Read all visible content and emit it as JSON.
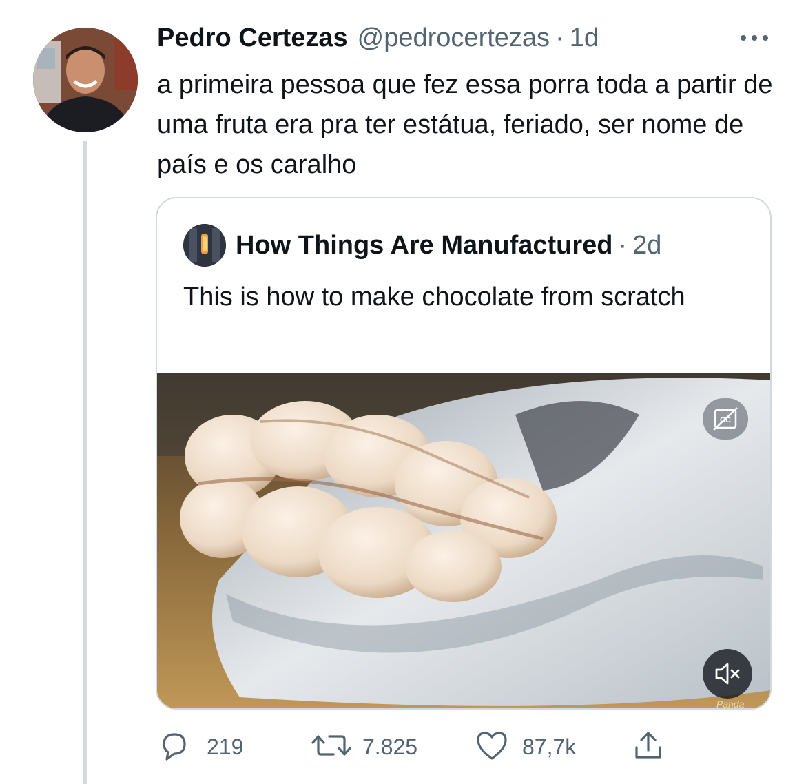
{
  "tweet": {
    "display_name": "Pedro Certezas",
    "handle": "@pedrocertezas",
    "separator": "·",
    "time": "1d",
    "text": "a primeira pessoa que fez essa porra toda a partir de uma fruta era pra ter estátua, feriado, ser nome de país e os caralho"
  },
  "quoted": {
    "display_name": "How Things Are Manufactured",
    "separator": "·",
    "time": "2d",
    "text": "This is how to make chocolate from scratch",
    "media_watermark": "Panda"
  },
  "actions": {
    "replies": "219",
    "retweets": "7.825",
    "likes": "87,7k"
  },
  "icons": {
    "more": "more-options-icon",
    "captions": "closed-captions-off-icon",
    "mute": "volume-muted-icon",
    "reply": "reply-icon",
    "retweet": "retweet-icon",
    "like": "heart-icon",
    "share": "share-icon"
  },
  "colors": {
    "text_primary": "#0f1419",
    "text_secondary": "#536471",
    "border": "#cfd9de",
    "thread_line": "#cfd9de"
  }
}
